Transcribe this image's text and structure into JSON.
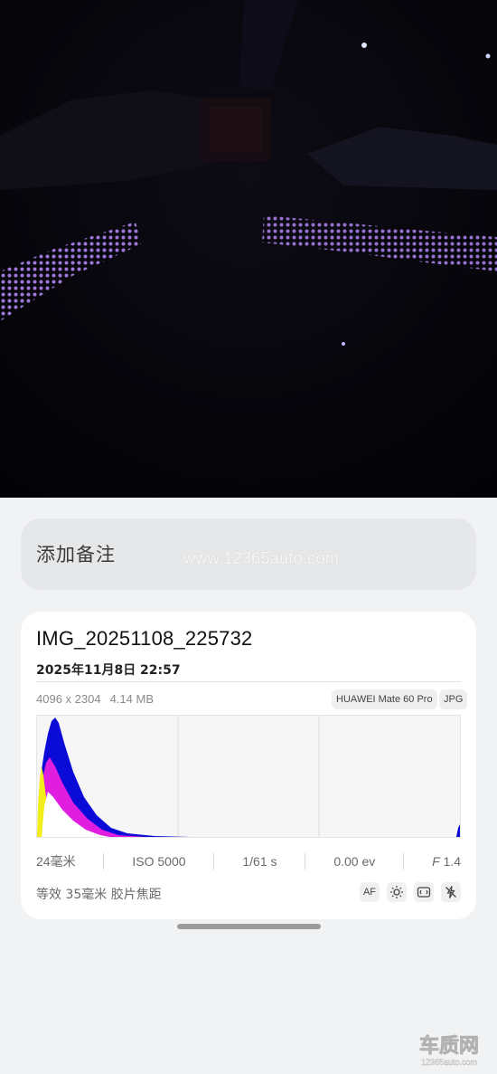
{
  "note": {
    "placeholder": "添加备注",
    "watermark": "www.12365auto.com"
  },
  "file": {
    "name": "IMG_20251108_225732",
    "datetime": "2025年11月8日 22:57",
    "resolution": "4096 x 2304",
    "size": "4.14 MB",
    "device": "HUAWEI Mate 60 Pro",
    "format": "JPG"
  },
  "exif": {
    "focal_length": "24毫米",
    "iso": "ISO 5000",
    "shutter": "1/61 s",
    "exposure": "0.00 ev",
    "aperture_prefix": "F",
    "aperture_value": "1.4",
    "equivalent_focal": "等效 35毫米 胶片焦距"
  },
  "modes": {
    "af": "AF"
  },
  "icons": [
    "sun-icon",
    "scan-icon",
    "flash-off-icon"
  ],
  "colors": {
    "blue_channel": "#0b0bd8",
    "magenta_channel": "#e01ee0",
    "yellow_channel": "#f2ee1a"
  },
  "logo": {
    "main": "车质网",
    "url": "12365auto.com"
  }
}
